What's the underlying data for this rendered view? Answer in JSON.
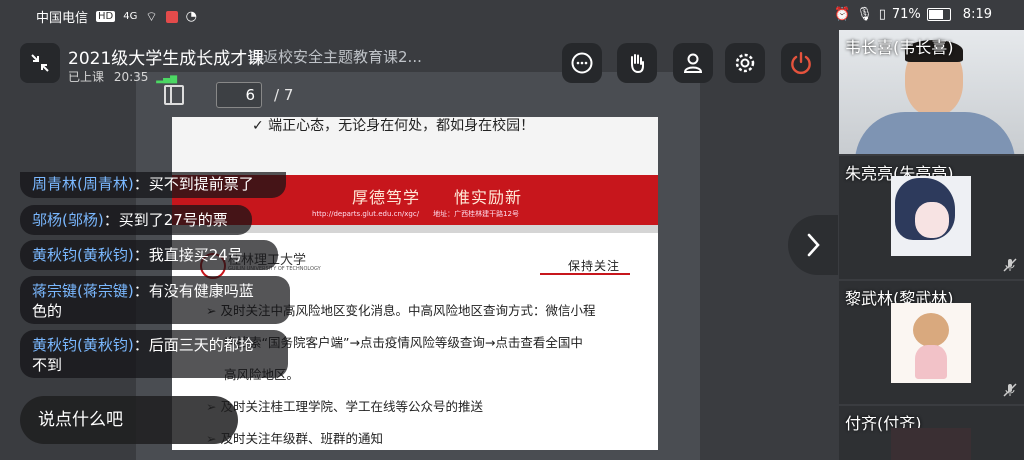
{
  "status_bar": {
    "carrier": "中国电信",
    "network_chip": "HD",
    "signal": "4G",
    "battery_percent": "71%",
    "time": "8:19"
  },
  "header": {
    "title": "2021级大学生成长成才课",
    "ghost_title": "期返校安全主题教育课2...",
    "subtitle": "已上课",
    "elapsed": "20:35"
  },
  "toolbar": {
    "chat_icon": "chat-bubble-icon",
    "raise_hand_icon": "raise-hand-icon",
    "members_icon": "person-icon",
    "settings_icon": "gear-icon",
    "leave_icon": "power-icon",
    "leave_color": "#e5533d"
  },
  "slide": {
    "current_page": "6",
    "total_pages": "/ 7",
    "top_line": "✓ 端正心态，无论身在何处，都如身在校园！",
    "banner_title": "厚德笃学　　惟实励新",
    "banner_url": "http://departs.glut.edu.cn/xgc/　　地址：广西桂林建干路12号",
    "logo_text": "桂林理工大学",
    "logo_sub": "GUILIN UNIVERSITY OF TECHNOLOGY",
    "section_label": "保持关注",
    "bullets": [
      "➢  及时关注中高风险地区变化消息。中高风险地区查询方式：微信小程",
      "序搜索“国务院客户端”→点击疫情风险等级查询→点击查看全国中",
      "高风险地区。",
      "➢  及时关注桂工理学院、学工在线等公众号的推送",
      "➢  及时关注年级群、班群的通知"
    ]
  },
  "chat": {
    "messages": [
      {
        "name": "周青林(周青林)",
        "text": "：买不到提前票了"
      },
      {
        "name": "邬杨(邬杨)",
        "text": "：买到了27号的票"
      },
      {
        "name": "黄秋钧(黄秋钧)",
        "text": "：我直接买24号"
      },
      {
        "name": "蒋宗键(蒋宗键)",
        "text": "：有没有健康吗蓝",
        "text2": "色的"
      },
      {
        "name": "黄秋钧(黄秋钧)",
        "text": "：后面三天的都抢",
        "text2": "不到"
      }
    ],
    "input_placeholder": "说点什么吧"
  },
  "participants": [
    {
      "name": "韦长喜(韦长喜)",
      "type": "video",
      "muted": false
    },
    {
      "name": "朱亮亮(朱亮亮)",
      "type": "avatar",
      "muted": true
    },
    {
      "name": "黎武林(黎武林)",
      "type": "avatar",
      "muted": true
    },
    {
      "name": "付齐(付齐)",
      "type": "avatar",
      "muted": false
    }
  ]
}
